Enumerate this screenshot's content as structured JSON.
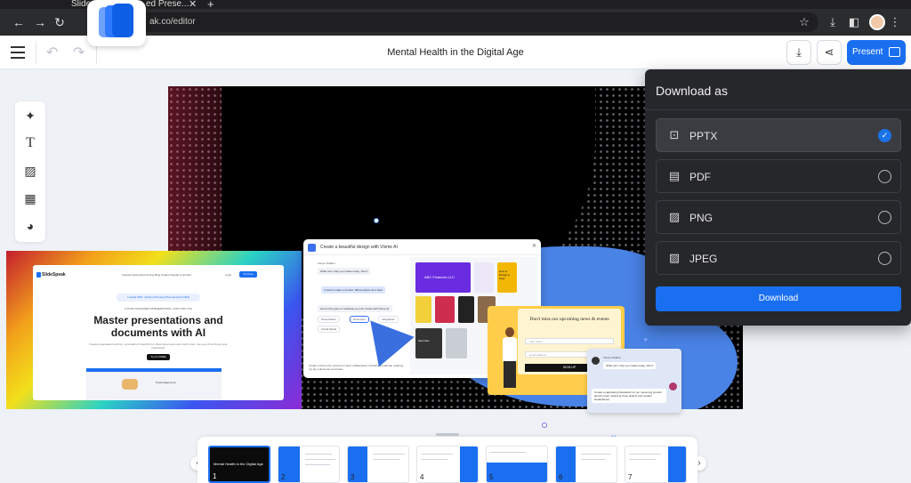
{
  "browser": {
    "tabs": [
      {
        "label": "Slide"
      },
      {
        "label": "ed Prese..."
      }
    ],
    "url": "ak.co/editor",
    "new_tab": "+",
    "close": "✕"
  },
  "header": {
    "title": "Mental Health in the Digital Age",
    "present_label": "Present"
  },
  "toolbar": {
    "tools": [
      "ai-sparkle",
      "text",
      "image-ai",
      "table",
      "palette"
    ]
  },
  "slide_content": {
    "mock_site": {
      "brand": "SlideSpeak",
      "nav": "Features   Enterprise   Pricing   Blog   Support   Speak in product",
      "login": "Login",
      "cta": "Try Free",
      "pill": "Limited Offer: Lifetime Premium Plus access for $29",
      "kicker": "A TOOL FOR EVERY PRESENTATION, JUST FOR YOU",
      "headline": "Master presentations and documents with AI",
      "body": "Create presentations with AI, summarize PowerPoint or Word documents and much more. Use your AI for boost your productivity.",
      "try": "Try for FREE",
      "preview_text": "Fresh ideas here"
    },
    "veone": {
      "title": "Create a beautiful design with Visme AI",
      "close": "✕",
      "chat": [
        "Visme Chatbot",
        "What can I help you create today, John?",
        "I need to make a content. What options do u have",
        "Here's the types of materials you can create with Visme AI:",
        "Presentation",
        "Document",
        "Infographic",
        "Social Media",
        "Create a Visme Pro account or team collaboration including a roadmap outlining my key milestones and tasks"
      ],
      "tiles": [
        "ABC Finances LLC",
        "Seminars",
        "How to Design a Flyer"
      ]
    },
    "newsletter": {
      "title": "Don't miss our upcoming news & events",
      "name_field": "Your name",
      "email_field": "Email address",
      "button": "SIGN UP"
    },
    "chat2": {
      "name": "Visme Chatbot",
      "question": "What can I help you create today, John?",
      "reply": "Create a captivating Newsletter for our upcoming product launch event, featuring three distinct and modern Headphones."
    }
  },
  "download_panel": {
    "title": "Download as",
    "options": [
      {
        "label": "PPTX",
        "icon": "presentation-icon",
        "selected": true
      },
      {
        "label": "PDF",
        "icon": "document-icon",
        "selected": false
      },
      {
        "label": "PNG",
        "icon": "image-icon",
        "selected": false
      },
      {
        "label": "JPEG",
        "icon": "image-icon",
        "selected": false
      }
    ],
    "button": "Download",
    "accent": "#1a6ff0"
  },
  "thumbnails": [
    {
      "num": "1",
      "title": "Mental Health in the Digital Age",
      "active": true
    },
    {
      "num": "2"
    },
    {
      "num": "3"
    },
    {
      "num": "4"
    },
    {
      "num": "5"
    },
    {
      "num": "6"
    },
    {
      "num": "7"
    }
  ]
}
